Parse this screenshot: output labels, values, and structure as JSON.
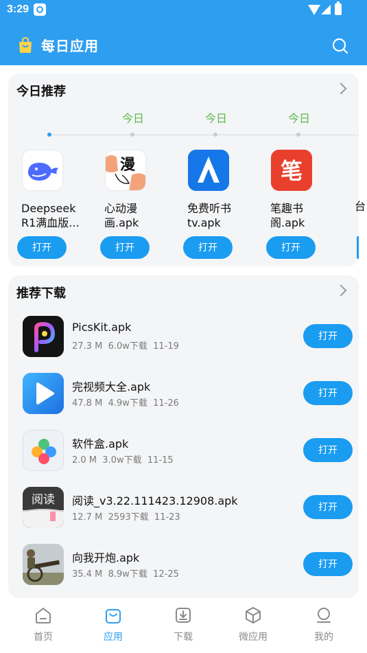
{
  "status_bar": {
    "time": "3:29"
  },
  "header": {
    "title": "每日应用",
    "icons": [
      "shopping-bag-icon",
      "search-icon"
    ]
  },
  "today": {
    "title": "今日推荐",
    "timeline_labels": [
      "今日",
      "今日",
      "今日"
    ],
    "apps": [
      {
        "name": "Deepseek R1满血版...",
        "open_label": "打开",
        "icon": "deepseek-whale-icon"
      },
      {
        "name": "心动漫画.apk",
        "open_label": "打开",
        "icon": "comic-icon"
      },
      {
        "name": "免费听书tv.apk",
        "open_label": "打开",
        "icon": "audiobook-icon"
      },
      {
        "name": "笔趣书阁.apk",
        "open_label": "打开",
        "icon": "biqu-icon"
      }
    ],
    "partial_app_name": "台"
  },
  "recommend": {
    "title": "推荐下载",
    "items": [
      {
        "name": "PicsKit.apk",
        "size": "27.3 M",
        "downloads": "6.0w下载",
        "date": "11-19",
        "open_label": "打开",
        "icon": "picskit-icon"
      },
      {
        "name": "完视频大全.apk",
        "size": "47.8 M",
        "downloads": "4.9w下载",
        "date": "11-26",
        "open_label": "打开",
        "icon": "video-play-icon"
      },
      {
        "name": "软件盒.apk",
        "size": "2.0 M",
        "downloads": "3.0w下载",
        "date": "11-15",
        "open_label": "打开",
        "icon": "software-box-icon"
      },
      {
        "name": "阅读_v3.22.111423.12908.apk",
        "size": "12.7 M",
        "downloads": "2593下载",
        "date": "11-23",
        "open_label": "打开",
        "icon": "reading-book-icon"
      },
      {
        "name": "向我开炮.apk",
        "size": "35.4 M",
        "downloads": "8.9w下载",
        "date": "12-25",
        "open_label": "打开",
        "icon": "cannon-soldier-icon"
      }
    ]
  },
  "bottom_nav": [
    {
      "label": "首页",
      "icon": "home-icon",
      "active": false
    },
    {
      "label": "应用",
      "icon": "app-bag-icon",
      "active": true
    },
    {
      "label": "下载",
      "icon": "download-icon",
      "active": false
    },
    {
      "label": "微应用",
      "icon": "cube-icon",
      "active": false
    },
    {
      "label": "我的",
      "icon": "profile-icon",
      "active": false
    }
  ],
  "colors": {
    "primary": "#2e9ef0",
    "button": "#1a9cf0",
    "timeline_label": "#5bb94a",
    "card_bg": "#f4f5f7"
  }
}
